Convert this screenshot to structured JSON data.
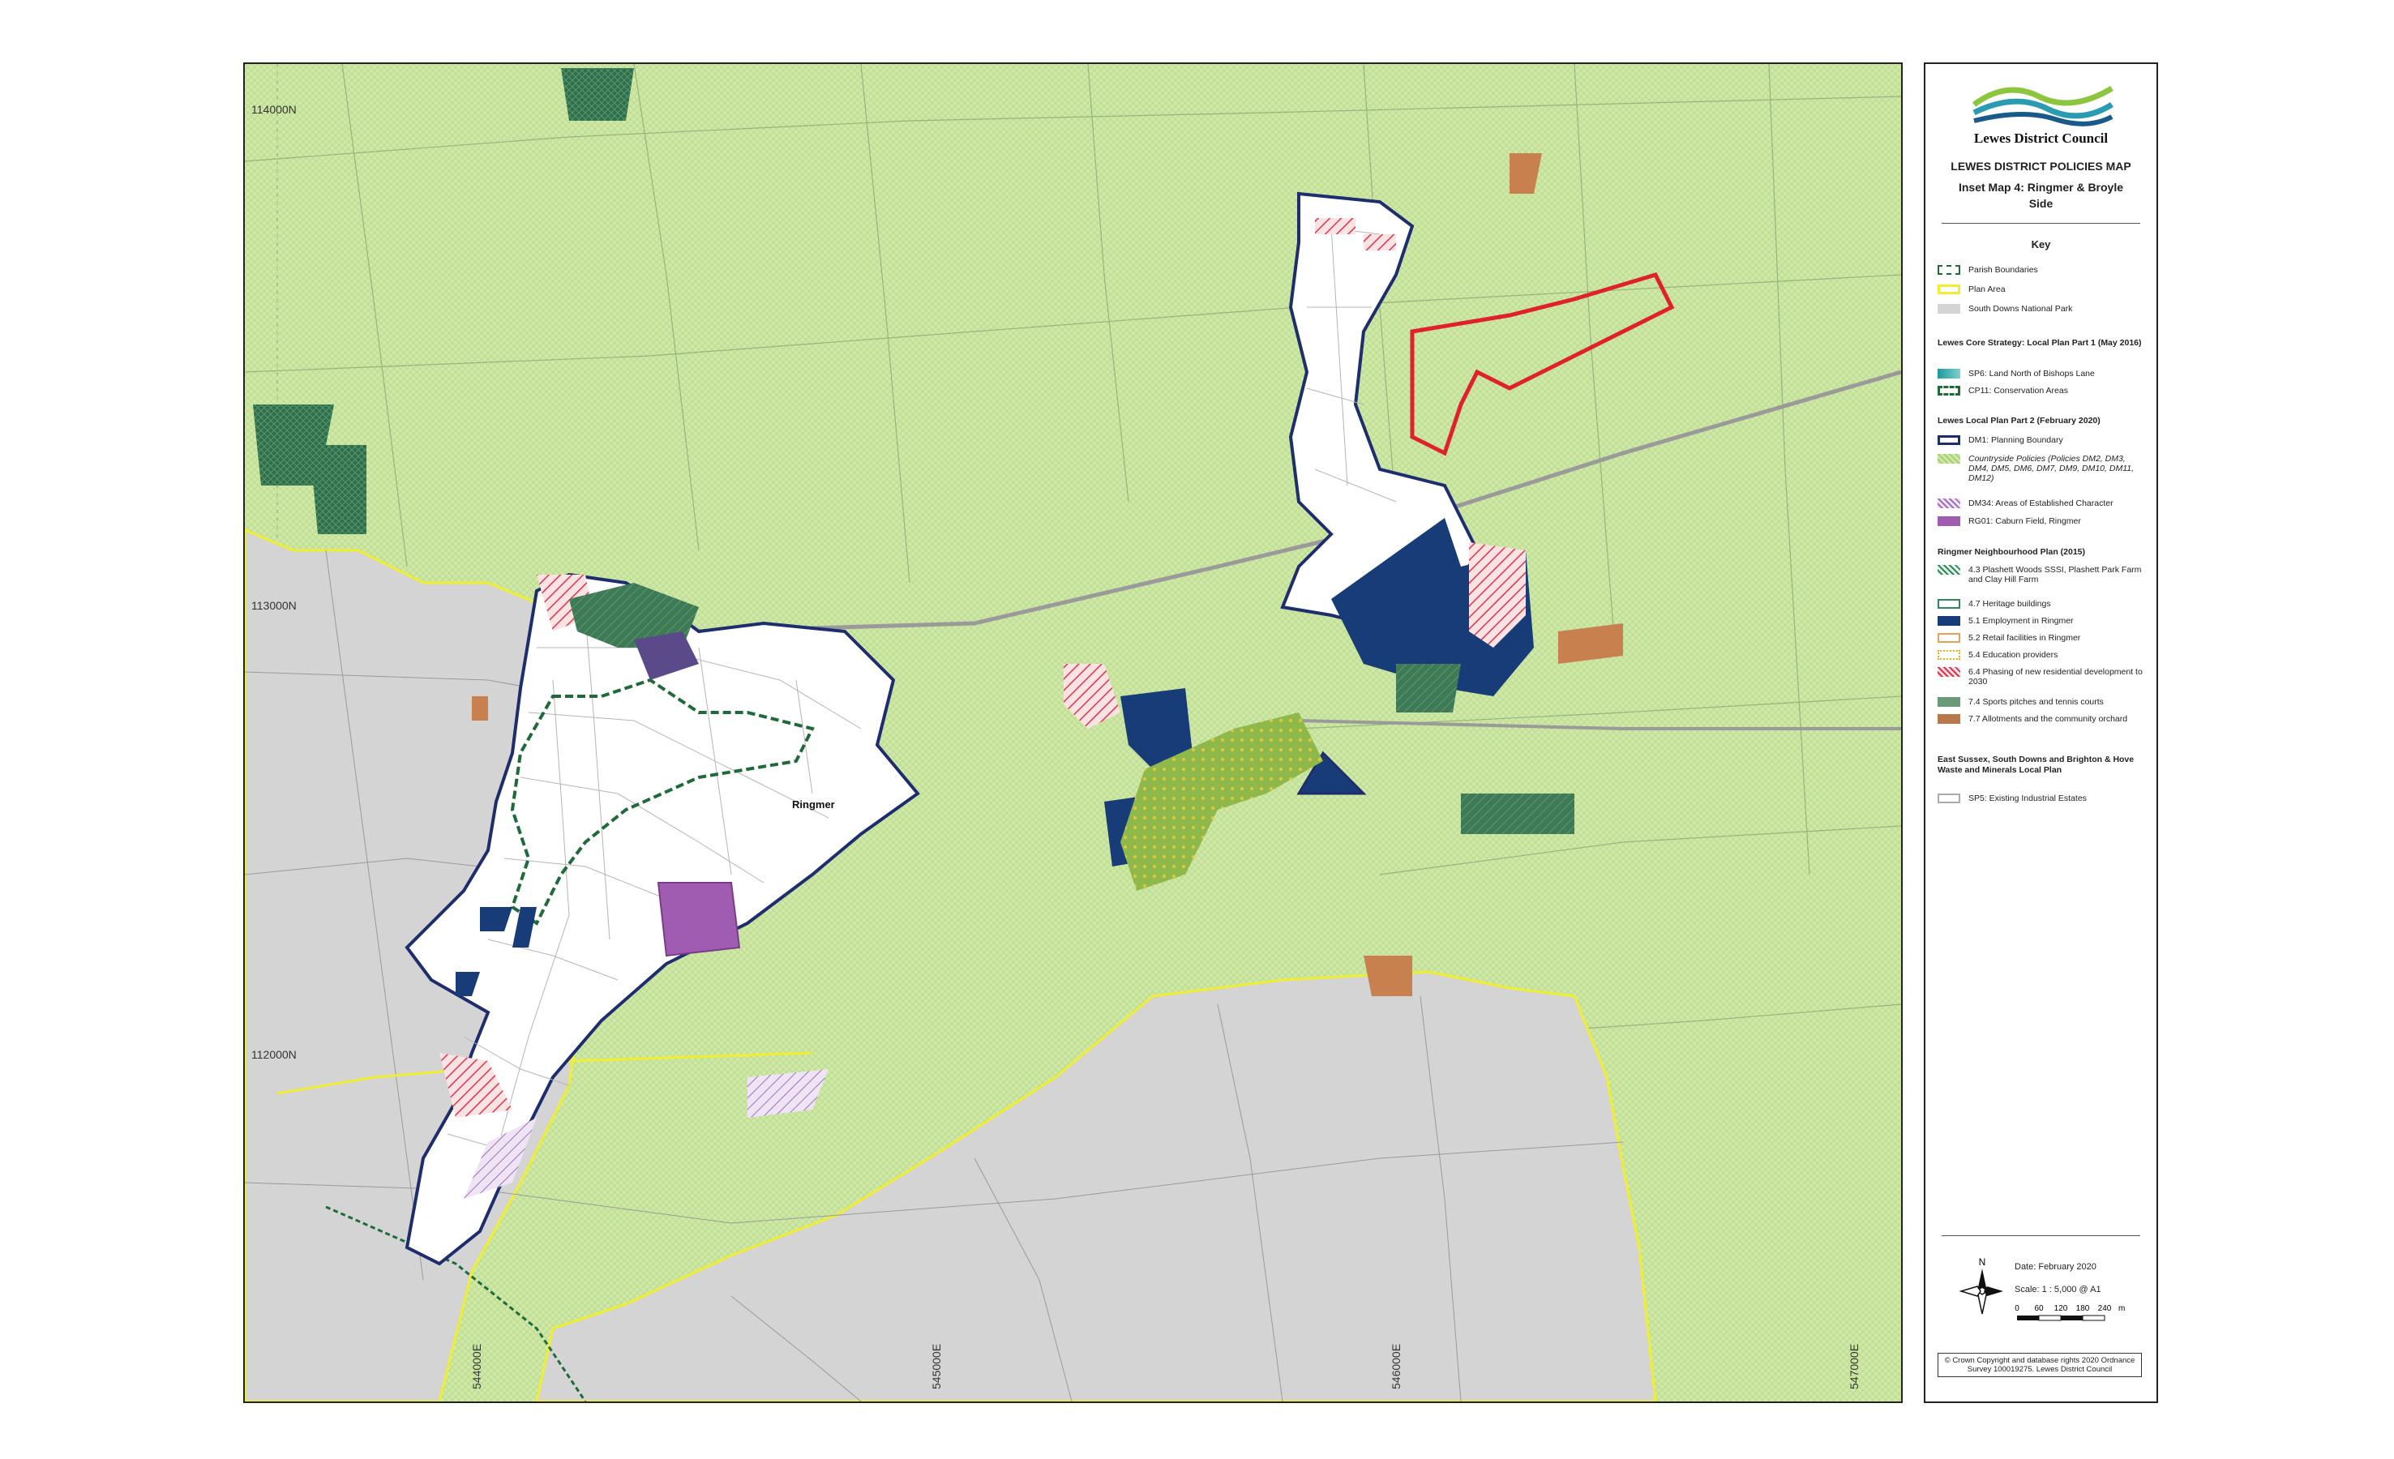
{
  "colors": {
    "countryside": "#cfe8a7",
    "national_park": "#d4d4d4",
    "plan_area": "#f0ee30",
    "planning_boundary": "#1d2d6e",
    "employment": "#173c77",
    "caburn_field": "#a05cb0",
    "sports": "#3d7a55",
    "phasing_red": "#e0344c",
    "allotments": "#c8804e",
    "conservation": "#1f6a3a"
  },
  "map": {
    "grid_labels": {
      "north_114000": "114000N",
      "north_113000": "113000N",
      "north_112000": "112000N",
      "east_544000": "544000E",
      "east_545000": "545000E",
      "east_546000": "546000E",
      "east_547000": "547000E"
    },
    "place_label": "Ringmer"
  },
  "legend": {
    "logo_icon": "lewes-district-council-logo",
    "council_name": "Lewes District Council",
    "map_title": "LEWES DISTRICT POLICIES MAP",
    "inset_title": "Inset Map 4: Ringmer & Broyle Side",
    "key_title": "Key",
    "general": [
      "Parish Boundaries",
      "Plan Area",
      "South Downs National Park"
    ],
    "core_strategy": {
      "title": "Lewes Core Strategy: Local Plan Part 1 (May 2016)",
      "items": [
        "SP6: Land North of Bishops Lane",
        "CP11: Conservation Areas"
      ]
    },
    "local_plan_2": {
      "title": "Lewes Local Plan Part 2 (February 2020)",
      "items": [
        "DM1: Planning Boundary",
        "Countryside Policies (Policies DM2, DM3, DM4, DM5, DM6, DM7, DM9, DM10, DM11, DM12)",
        "DM34: Areas of Established Character",
        "RG01: Caburn Field, Ringmer"
      ]
    },
    "neighbourhood_plan": {
      "title": "Ringmer Neighbourhood Plan (2015)",
      "items": [
        "4.3 Plashett Woods SSSI, Plashett Park Farm and Clay Hill Farm",
        "4.7 Heritage buildings",
        "5.1 Employment in Ringmer",
        "5.2 Retail facilities in Ringmer",
        "5.4 Education providers",
        "6.4 Phasing of new residential development to 2030",
        "7.4 Sports pitches and tennis courts",
        "7.7 Allotments and the community orchard"
      ]
    },
    "waste_minerals": {
      "title": "East Sussex, South Downs and Brighton & Hove Waste and Minerals Local Plan",
      "items": [
        "SP5: Existing Industrial Estates"
      ]
    },
    "date": "Date:  February 2020",
    "scale": "Scale: 1 : 5,000 @ A1",
    "scalebar_ticks": [
      "0",
      "60",
      "120",
      "180",
      "240",
      "m"
    ],
    "north_label": "N",
    "copyright": "© Crown Copyright and database rights 2020 Ordnance Survey 100019275. Lewes District Council"
  }
}
